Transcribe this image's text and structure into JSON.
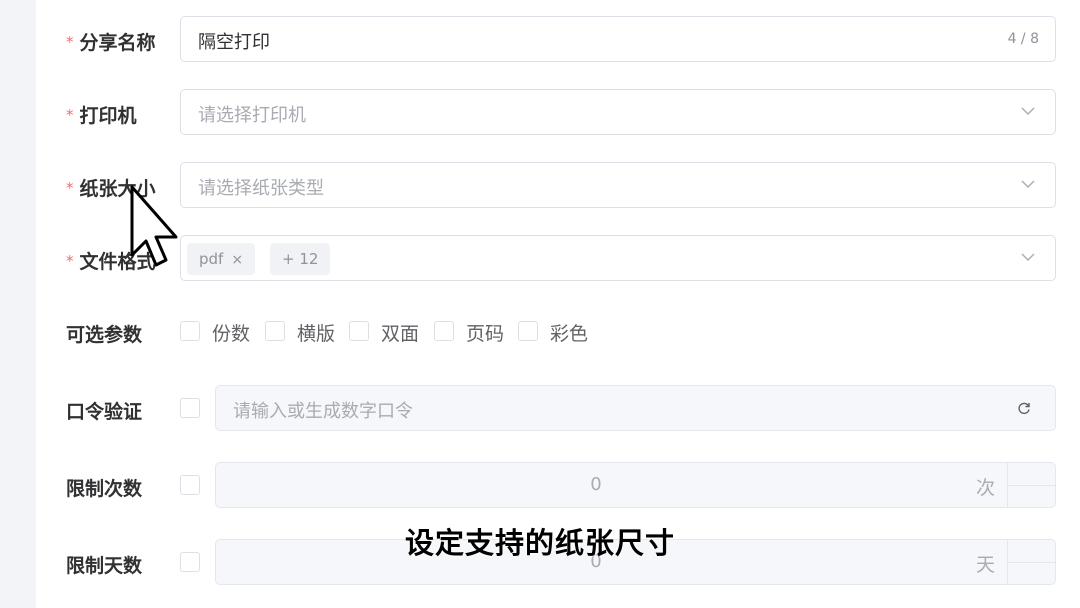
{
  "form": {
    "share_name": {
      "label": "分享名称",
      "required_mark": "*",
      "value": "隔空打印",
      "counter": "4 / 8"
    },
    "printer": {
      "label": "打印机",
      "required_mark": "*",
      "placeholder": "请选择打印机"
    },
    "paper_size": {
      "label": "纸张大小",
      "required_mark": "*",
      "placeholder": "请选择纸张类型"
    },
    "file_format": {
      "label": "文件格式",
      "required_mark": "*",
      "tags": [
        "pdf",
        "+ 12"
      ],
      "tag_close": "×"
    },
    "optional_params": {
      "label": "可选参数",
      "options": [
        "份数",
        "横版",
        "双面",
        "页码",
        "彩色"
      ]
    },
    "password": {
      "label": "口令验证",
      "placeholder": "请输入或生成数字口令",
      "icon": "refresh-icon"
    },
    "limit_count": {
      "label": "限制次数",
      "value": "0",
      "unit": "次"
    },
    "limit_days": {
      "label": "限制天数",
      "value": "0",
      "unit": "天"
    }
  },
  "caption": "设定支持的纸张尺寸",
  "colors": {
    "required": "#f56c6c",
    "border": "#dcdfe6",
    "disabled_bg": "#f5f7fa",
    "placeholder": "#a8abb2"
  }
}
